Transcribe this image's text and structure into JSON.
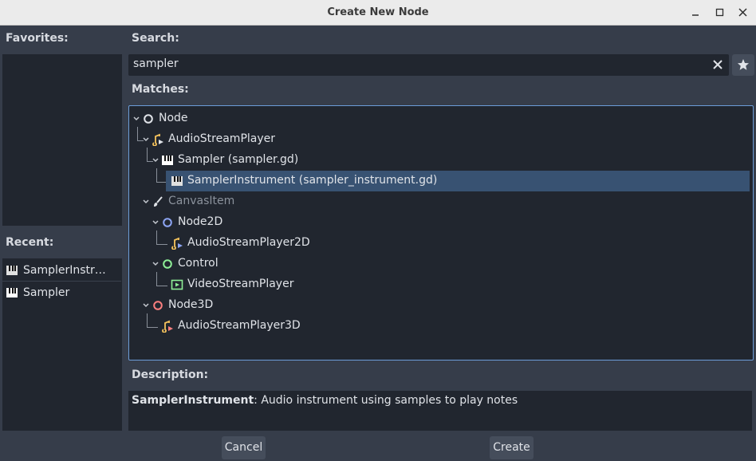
{
  "window": {
    "title": "Create New Node"
  },
  "favorites": {
    "label": "Favorites:"
  },
  "recent": {
    "label": "Recent:",
    "items": [
      {
        "label": "SamplerInstru…",
        "icon": "piano-keys-icon"
      },
      {
        "label": "Sampler",
        "icon": "piano-keys-icon"
      }
    ]
  },
  "search": {
    "label": "Search:",
    "value": "sampler"
  },
  "matches": {
    "label": "Matches:",
    "tree": [
      {
        "label": "Node",
        "icon": "node-circle-icon"
      },
      {
        "label": "AudioStreamPlayer",
        "icon": "audio-stream-icon"
      },
      {
        "label": "Sampler (sampler.gd)",
        "icon": "piano-keys-icon"
      },
      {
        "label": "SamplerInstrument (sampler_instrument.gd)",
        "icon": "piano-keys-icon",
        "selected": true
      },
      {
        "label": "CanvasItem",
        "icon": "brush-icon",
        "dimmed": true
      },
      {
        "label": "Node2D",
        "icon": "node2d-circle-icon"
      },
      {
        "label": "AudioStreamPlayer2D",
        "icon": "audio-stream-2d-icon"
      },
      {
        "label": "Control",
        "icon": "control-circle-icon"
      },
      {
        "label": "VideoStreamPlayer",
        "icon": "video-player-icon"
      },
      {
        "label": "Node3D",
        "icon": "node3d-circle-icon"
      },
      {
        "label": "AudioStreamPlayer3D",
        "icon": "audio-stream-3d-icon"
      }
    ]
  },
  "description": {
    "label": "Description:",
    "class_name": "SamplerInstrument",
    "text": ": Audio instrument using samples to play notes"
  },
  "buttons": {
    "cancel": "Cancel",
    "create": "Create"
  },
  "colors": {
    "selection": "#385272",
    "focus_border": "#6c9dd8",
    "node2d": "#8da5f3",
    "control": "#8eef97",
    "node3d": "#fc7f7f"
  }
}
